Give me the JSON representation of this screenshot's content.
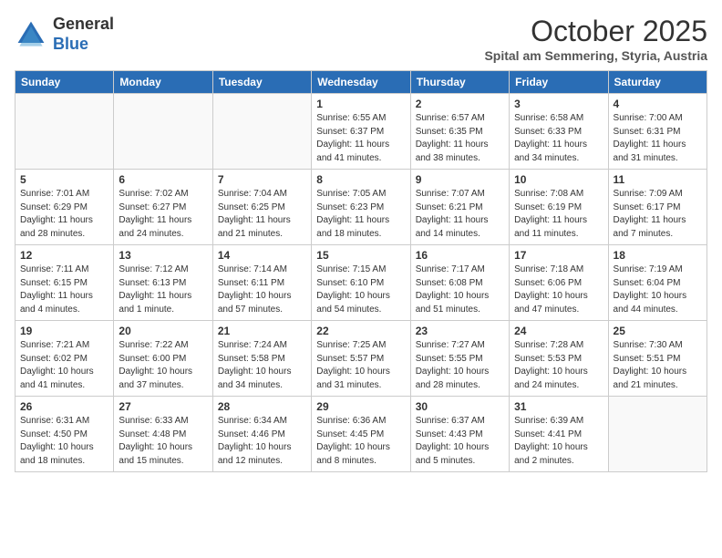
{
  "header": {
    "logo_general": "General",
    "logo_blue": "Blue",
    "month": "October 2025",
    "location": "Spital am Semmering, Styria, Austria"
  },
  "days_of_week": [
    "Sunday",
    "Monday",
    "Tuesday",
    "Wednesday",
    "Thursday",
    "Friday",
    "Saturday"
  ],
  "weeks": [
    [
      {
        "day": "",
        "info": ""
      },
      {
        "day": "",
        "info": ""
      },
      {
        "day": "",
        "info": ""
      },
      {
        "day": "1",
        "info": "Sunrise: 6:55 AM\nSunset: 6:37 PM\nDaylight: 11 hours and 41 minutes."
      },
      {
        "day": "2",
        "info": "Sunrise: 6:57 AM\nSunset: 6:35 PM\nDaylight: 11 hours and 38 minutes."
      },
      {
        "day": "3",
        "info": "Sunrise: 6:58 AM\nSunset: 6:33 PM\nDaylight: 11 hours and 34 minutes."
      },
      {
        "day": "4",
        "info": "Sunrise: 7:00 AM\nSunset: 6:31 PM\nDaylight: 11 hours and 31 minutes."
      }
    ],
    [
      {
        "day": "5",
        "info": "Sunrise: 7:01 AM\nSunset: 6:29 PM\nDaylight: 11 hours and 28 minutes."
      },
      {
        "day": "6",
        "info": "Sunrise: 7:02 AM\nSunset: 6:27 PM\nDaylight: 11 hours and 24 minutes."
      },
      {
        "day": "7",
        "info": "Sunrise: 7:04 AM\nSunset: 6:25 PM\nDaylight: 11 hours and 21 minutes."
      },
      {
        "day": "8",
        "info": "Sunrise: 7:05 AM\nSunset: 6:23 PM\nDaylight: 11 hours and 18 minutes."
      },
      {
        "day": "9",
        "info": "Sunrise: 7:07 AM\nSunset: 6:21 PM\nDaylight: 11 hours and 14 minutes."
      },
      {
        "day": "10",
        "info": "Sunrise: 7:08 AM\nSunset: 6:19 PM\nDaylight: 11 hours and 11 minutes."
      },
      {
        "day": "11",
        "info": "Sunrise: 7:09 AM\nSunset: 6:17 PM\nDaylight: 11 hours and 7 minutes."
      }
    ],
    [
      {
        "day": "12",
        "info": "Sunrise: 7:11 AM\nSunset: 6:15 PM\nDaylight: 11 hours and 4 minutes."
      },
      {
        "day": "13",
        "info": "Sunrise: 7:12 AM\nSunset: 6:13 PM\nDaylight: 11 hours and 1 minute."
      },
      {
        "day": "14",
        "info": "Sunrise: 7:14 AM\nSunset: 6:11 PM\nDaylight: 10 hours and 57 minutes."
      },
      {
        "day": "15",
        "info": "Sunrise: 7:15 AM\nSunset: 6:10 PM\nDaylight: 10 hours and 54 minutes."
      },
      {
        "day": "16",
        "info": "Sunrise: 7:17 AM\nSunset: 6:08 PM\nDaylight: 10 hours and 51 minutes."
      },
      {
        "day": "17",
        "info": "Sunrise: 7:18 AM\nSunset: 6:06 PM\nDaylight: 10 hours and 47 minutes."
      },
      {
        "day": "18",
        "info": "Sunrise: 7:19 AM\nSunset: 6:04 PM\nDaylight: 10 hours and 44 minutes."
      }
    ],
    [
      {
        "day": "19",
        "info": "Sunrise: 7:21 AM\nSunset: 6:02 PM\nDaylight: 10 hours and 41 minutes."
      },
      {
        "day": "20",
        "info": "Sunrise: 7:22 AM\nSunset: 6:00 PM\nDaylight: 10 hours and 37 minutes."
      },
      {
        "day": "21",
        "info": "Sunrise: 7:24 AM\nSunset: 5:58 PM\nDaylight: 10 hours and 34 minutes."
      },
      {
        "day": "22",
        "info": "Sunrise: 7:25 AM\nSunset: 5:57 PM\nDaylight: 10 hours and 31 minutes."
      },
      {
        "day": "23",
        "info": "Sunrise: 7:27 AM\nSunset: 5:55 PM\nDaylight: 10 hours and 28 minutes."
      },
      {
        "day": "24",
        "info": "Sunrise: 7:28 AM\nSunset: 5:53 PM\nDaylight: 10 hours and 24 minutes."
      },
      {
        "day": "25",
        "info": "Sunrise: 7:30 AM\nSunset: 5:51 PM\nDaylight: 10 hours and 21 minutes."
      }
    ],
    [
      {
        "day": "26",
        "info": "Sunrise: 6:31 AM\nSunset: 4:50 PM\nDaylight: 10 hours and 18 minutes."
      },
      {
        "day": "27",
        "info": "Sunrise: 6:33 AM\nSunset: 4:48 PM\nDaylight: 10 hours and 15 minutes."
      },
      {
        "day": "28",
        "info": "Sunrise: 6:34 AM\nSunset: 4:46 PM\nDaylight: 10 hours and 12 minutes."
      },
      {
        "day": "29",
        "info": "Sunrise: 6:36 AM\nSunset: 4:45 PM\nDaylight: 10 hours and 8 minutes."
      },
      {
        "day": "30",
        "info": "Sunrise: 6:37 AM\nSunset: 4:43 PM\nDaylight: 10 hours and 5 minutes."
      },
      {
        "day": "31",
        "info": "Sunrise: 6:39 AM\nSunset: 4:41 PM\nDaylight: 10 hours and 2 minutes."
      },
      {
        "day": "",
        "info": ""
      }
    ]
  ]
}
